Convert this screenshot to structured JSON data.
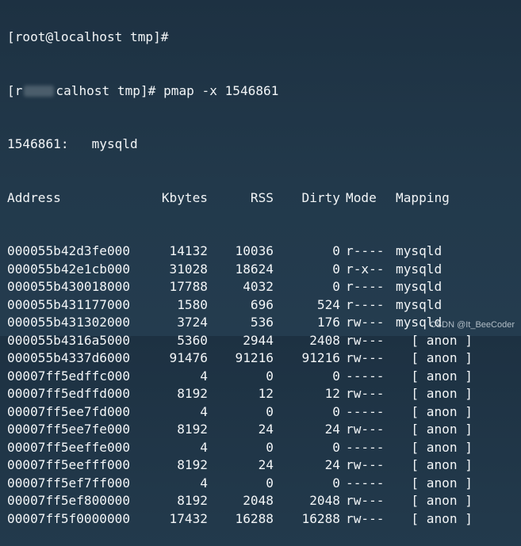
{
  "terminal": {
    "prompt_top": "[root@localhost tmp]#",
    "prompt_user_visible": "[r",
    "prompt_host_visible": "calhost tmp]#",
    "command": "pmap -x 1546861",
    "pid_line": "1546861:   mysqld",
    "headers": [
      "Address",
      "Kbytes",
      "RSS",
      "Dirty",
      "Mode",
      "Mapping"
    ],
    "rows": [
      {
        "address": "000055b42d3fe000",
        "kbytes": "14132",
        "rss": "10036",
        "dirty": "0",
        "mode": "r----",
        "mapping": "mysqld"
      },
      {
        "address": "000055b42e1cb000",
        "kbytes": "31028",
        "rss": "18624",
        "dirty": "0",
        "mode": "r-x--",
        "mapping": "mysqld"
      },
      {
        "address": "000055b430018000",
        "kbytes": "17788",
        "rss": "4032",
        "dirty": "0",
        "mode": "r----",
        "mapping": "mysqld"
      },
      {
        "address": "000055b431177000",
        "kbytes": "1580",
        "rss": "696",
        "dirty": "524",
        "mode": "r----",
        "mapping": "mysqld"
      },
      {
        "address": "000055b431302000",
        "kbytes": "3724",
        "rss": "536",
        "dirty": "176",
        "mode": "rw---",
        "mapping": "mysqld"
      },
      {
        "address": "000055b4316a5000",
        "kbytes": "5360",
        "rss": "2944",
        "dirty": "2408",
        "mode": "rw---",
        "mapping": "  [ anon ]"
      },
      {
        "address": "000055b4337d6000",
        "kbytes": "91476",
        "rss": "91216",
        "dirty": "91216",
        "mode": "rw---",
        "mapping": "  [ anon ]"
      },
      {
        "address": "00007ff5edffc000",
        "kbytes": "4",
        "rss": "0",
        "dirty": "0",
        "mode": "-----",
        "mapping": "  [ anon ]"
      },
      {
        "address": "00007ff5edffd000",
        "kbytes": "8192",
        "rss": "12",
        "dirty": "12",
        "mode": "rw---",
        "mapping": "  [ anon ]"
      },
      {
        "address": "00007ff5ee7fd000",
        "kbytes": "4",
        "rss": "0",
        "dirty": "0",
        "mode": "-----",
        "mapping": "  [ anon ]"
      },
      {
        "address": "00007ff5ee7fe000",
        "kbytes": "8192",
        "rss": "24",
        "dirty": "24",
        "mode": "rw---",
        "mapping": "  [ anon ]"
      },
      {
        "address": "00007ff5eeffe000",
        "kbytes": "4",
        "rss": "0",
        "dirty": "0",
        "mode": "-----",
        "mapping": "  [ anon ]"
      },
      {
        "address": "00007ff5eefff000",
        "kbytes": "8192",
        "rss": "24",
        "dirty": "24",
        "mode": "rw---",
        "mapping": "  [ anon ]"
      },
      {
        "address": "00007ff5ef7ff000",
        "kbytes": "4",
        "rss": "0",
        "dirty": "0",
        "mode": "-----",
        "mapping": "  [ anon ]"
      },
      {
        "address": "00007ff5ef800000",
        "kbytes": "8192",
        "rss": "2048",
        "dirty": "2048",
        "mode": "rw---",
        "mapping": "  [ anon ]"
      }
    ],
    "partial_last_row": {
      "address": "00007ff5f0000000",
      "kbytes": "17432",
      "rss": "16288",
      "dirty": "16288",
      "mode": "rw---",
      "mapping": "  [ anon ]"
    }
  },
  "watermark": "CSDN @It_BeeCoder",
  "colors": {
    "background": "#1f3343",
    "text": "#f2f5f7"
  }
}
